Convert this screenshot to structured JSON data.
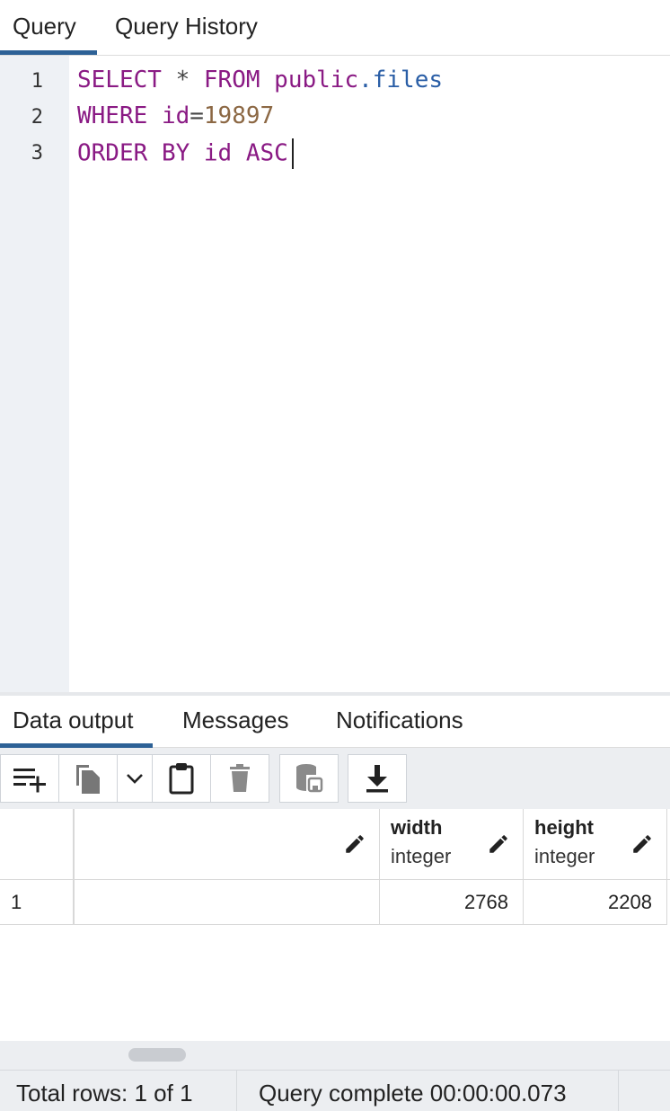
{
  "top_tabs": {
    "query": "Query",
    "history": "Query History"
  },
  "editor": {
    "line_numbers": [
      "1",
      "2",
      "3"
    ],
    "line1": {
      "select": "SELECT",
      "star": "*",
      "from": "FROM",
      "schema": "public",
      "dot": ".",
      "table": "files"
    },
    "line2": {
      "where": "WHERE",
      "col": "id",
      "eq": "=",
      "value": "19897"
    },
    "line3": {
      "order": "ORDER",
      "by": "BY",
      "col": "id",
      "dir": "ASC"
    }
  },
  "bottom_tabs": {
    "data_output": "Data output",
    "messages": "Messages",
    "notifications": "Notifications"
  },
  "toolbar": {
    "icons": [
      "add-row-icon",
      "copy-icon",
      "chevron-down-icon",
      "paste-icon",
      "trash-icon",
      "save-data-icon",
      "download-icon"
    ]
  },
  "grid": {
    "columns": [
      {
        "name": "",
        "type": ""
      },
      {
        "name": "width",
        "type": "integer"
      },
      {
        "name": "height",
        "type": "integer"
      }
    ],
    "rows": [
      {
        "row_no": "1",
        "cells": [
          "",
          "2768",
          "2208"
        ]
      }
    ]
  },
  "status": {
    "rows": "Total rows: 1 of 1",
    "complete": "Query complete 00:00:00.073"
  },
  "colors": {
    "accent": "#2d6196",
    "keyword": "#8a1a84",
    "identifier": "#2a5ea6",
    "number": "#8c6844"
  }
}
